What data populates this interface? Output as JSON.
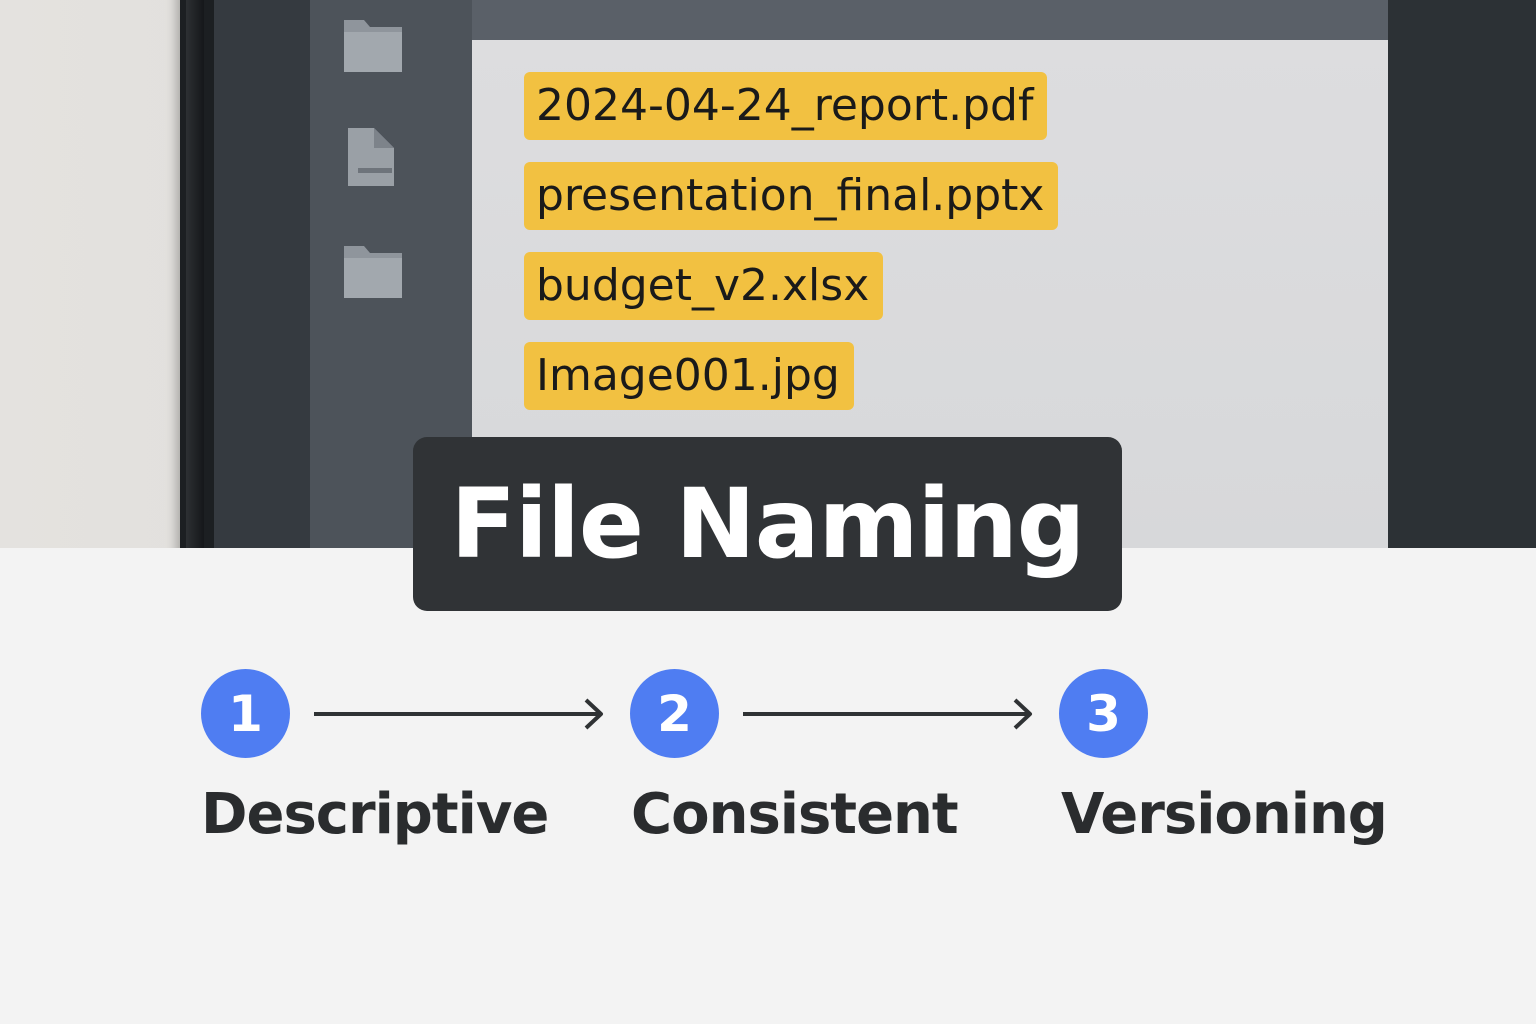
{
  "files": [
    {
      "name": "2024-04-24_report.pdf"
    },
    {
      "name": "presentation_final.pptx"
    },
    {
      "name": "budget_v2.xlsx"
    },
    {
      "name": "Image001.jpg"
    }
  ],
  "sidebar_icons": [
    "folder-icon",
    "document-icon",
    "folder-icon"
  ],
  "title": "File Naming",
  "steps": [
    {
      "number": "1",
      "label": "Descriptive"
    },
    {
      "number": "2",
      "label": "Consistent"
    },
    {
      "number": "3",
      "label": "Versioning"
    }
  ],
  "colors": {
    "highlight": "#f2c141",
    "step_circle": "#4f7df2",
    "title_badge": "#303336",
    "text_dark": "#2a2c2e"
  }
}
